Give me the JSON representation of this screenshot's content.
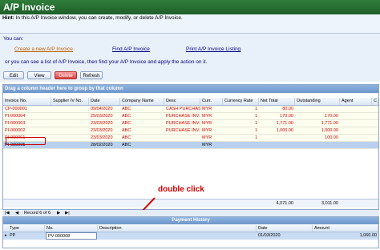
{
  "window": {
    "title": "A/P Invoice"
  },
  "hint": {
    "label": "Hint:",
    "text": "In this A/P Invoice window, you can create, modify, or delete A/P Invoice."
  },
  "can_do": {
    "heading": "You can:",
    "links": [
      "Create a new A/P Invoice",
      "Find A/P Invoice",
      "Print A/P Invoice Listing"
    ],
    "or_text": "or you can see a list of A/P Invoice, then find your A/P Invoice and apply the action on it."
  },
  "toolbar": {
    "edit": "Edit",
    "view": "View",
    "delete": "Delete",
    "refresh": "Refresh"
  },
  "grid": {
    "group_hint": "Drag a column header here to group by that column",
    "columns": [
      "Invoice No.",
      "Supplier IV No.",
      "Date",
      "Company Name",
      "Desc",
      "Curr.",
      "Currency Rate",
      "Net Total",
      "Outstanding",
      "Agent",
      "C"
    ],
    "rows": [
      {
        "invoice": "CP-000001",
        "supplier": "",
        "date": "09/04/2020",
        "company": "ABC",
        "desc": "CASH PURCHASE",
        "curr": "MYR",
        "rate": "1",
        "net": "80.00",
        "outstanding": "",
        "red": true
      },
      {
        "invoice": "PI-000004",
        "supplier": "",
        "date": "25/03/2020",
        "company": "ABC",
        "desc": "PURCHASE INV...",
        "curr": "MYR",
        "rate": "1",
        "net": "170.00",
        "outstanding": "170.00",
        "red": true
      },
      {
        "invoice": "PI-000003",
        "supplier": "",
        "date": "23/03/2020",
        "company": "ABC",
        "desc": "PURCHASE INV...",
        "curr": "MYR",
        "rate": "1",
        "net": "1,771.00",
        "outstanding": "1,771.00",
        "red": true
      },
      {
        "invoice": "PI-000002",
        "supplier": "",
        "date": "23/03/2020",
        "company": "ABC",
        "desc": "PURCHASE INV...",
        "curr": "MYR",
        "rate": "1",
        "net": "1,000.00",
        "outstanding": "1,000.00",
        "red": true
      },
      {
        "invoice": "PI-000001",
        "supplier": "",
        "date": "23/03/2020",
        "company": "ABC",
        "desc": "",
        "curr": "MYR",
        "rate": "1",
        "net": "",
        "outstanding": "100.00",
        "red": true
      },
      {
        "invoice": "PI-000005",
        "supplier": "",
        "date": "28/02/2020",
        "company": "ABC",
        "desc": "",
        "curr": "MYR",
        "rate": "",
        "net": "",
        "outstanding": "",
        "red": false
      }
    ],
    "totals": {
      "net": "4,071.00",
      "outstanding": "3,011.00"
    },
    "nav": {
      "record": "Record 6 of 6"
    }
  },
  "annotation": {
    "text": "double click"
  },
  "payment_history": {
    "title": "Payment History",
    "columns": [
      "Type",
      "No.",
      "Description",
      "Date",
      "Amount"
    ],
    "row": {
      "type": "PP",
      "no": "PV-000008",
      "description": "",
      "date": "01/03/2020",
      "amount": "1,060.00"
    }
  }
}
